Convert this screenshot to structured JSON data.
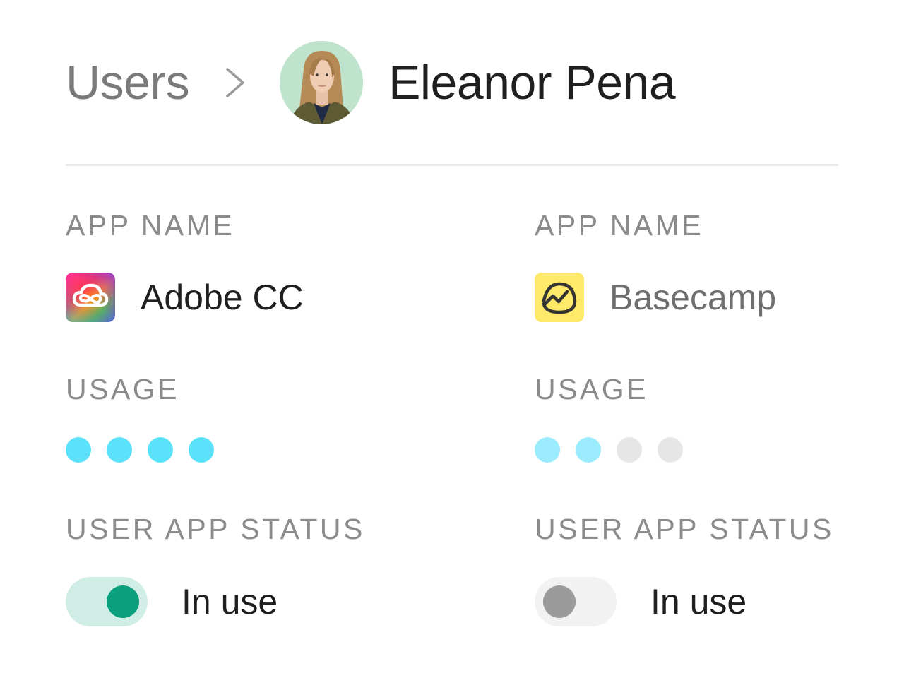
{
  "breadcrumb": {
    "parent": "Users",
    "current": "Eleanor Pena"
  },
  "colors": {
    "label": "#8b8b8b",
    "dot_active": "#5ce1fb",
    "dot_light": "#9aecfd",
    "dot_empty": "#e6e6e6",
    "toggle_on_track": "#d1eee6",
    "toggle_on_knob": "#0aa07d",
    "toggle_off_track": "#f2f2f2",
    "toggle_off_knob": "#9b9b9b"
  },
  "apps": [
    {
      "app_name_label": "APP NAME",
      "app_name": "Adobe CC",
      "icon": "adobe-creative-cloud-icon",
      "usage_label": "USAGE",
      "usage_level": 4,
      "usage_max": 4,
      "status_label": "USER APP STATUS",
      "status_text": "In use",
      "toggle_on": true
    },
    {
      "app_name_label": "APP NAME",
      "app_name": "Basecamp",
      "icon": "basecamp-icon",
      "usage_label": "USAGE",
      "usage_level": 2,
      "usage_max": 4,
      "status_label": "USER APP STATUS",
      "status_text": "In use",
      "toggle_on": false
    }
  ]
}
